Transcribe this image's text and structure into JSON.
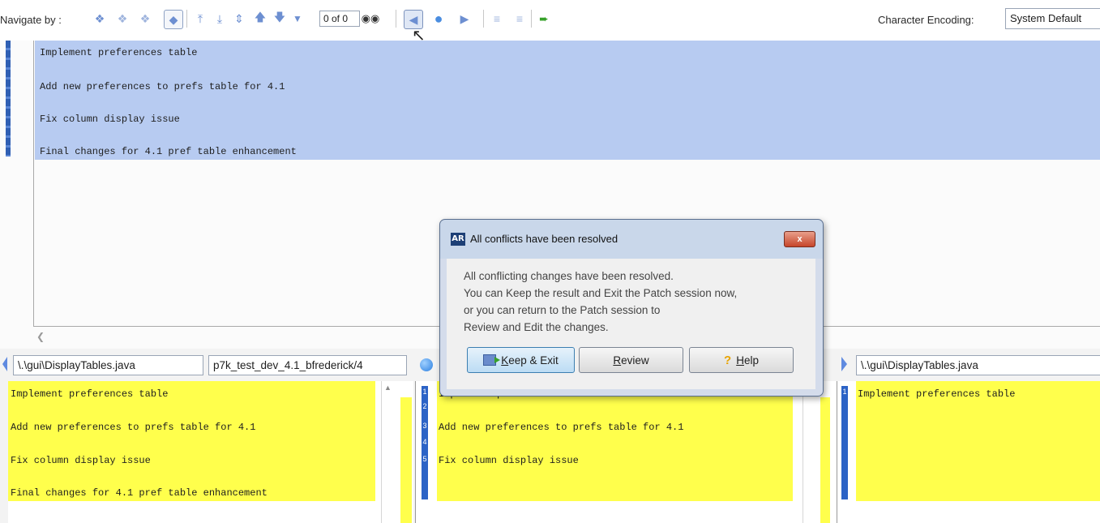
{
  "toolbar": {
    "navigate_label": "Navigate by :",
    "position_value": "0 of 0",
    "encoding_label": "Character Encoding:",
    "encoding_value": "System Default"
  },
  "icons": [
    "diff-nav-icon",
    "prev-diff-icon",
    "next-diff-icon",
    "all-diff-icon",
    "first-change-icon",
    "last-change-icon",
    "expand-icon",
    "up-arrow-icon",
    "down-arrow-icon",
    "find-icon",
    "left-arrow-icon",
    "circle-icon",
    "right-arrow-icon",
    "merge-icon",
    "merge-all-icon",
    "keep-exit-icon"
  ],
  "result_pane": {
    "lines": [
      "Implement preferences table",
      "Add new preferences to prefs table for 4.1",
      "Fix column display issue",
      "Final changes for 4.1 pref table enhancement"
    ]
  },
  "left_pane": {
    "file": "\\.\\gui\\DisplayTables.java",
    "version": "p7k_test_dev_4.1_bfrederick/4",
    "lines": [
      "Implement preferences table",
      "Add new preferences to prefs table for 4.1",
      "Fix column display issue",
      "Final changes for 4.1 pref table enhancement"
    ]
  },
  "middle_pane": {
    "line_numbers": [
      "1",
      "2",
      "3",
      "4",
      "5"
    ],
    "lines": [
      "Implement preferences table",
      "Add new preferences to prefs table for 4.1",
      "Fix column display issue"
    ]
  },
  "right_pane": {
    "file": "\\.\\gui\\DisplayTables.java",
    "line_numbers": [
      "1"
    ],
    "lines": [
      "Implement preferences table"
    ]
  },
  "dialog": {
    "icon_text": "AR",
    "title": "All conflicts have been resolved",
    "close": "x",
    "message": [
      "All conflicting changes have been resolved.",
      "You can Keep the result and Exit the Patch session now,",
      "or you can return to the Patch session to",
      "Review and Edit the changes."
    ],
    "buttons": {
      "keep_exit_mnemonic": "K",
      "keep_exit_rest": "eep & Exit",
      "review_mnemonic": "R",
      "review_rest": "eview",
      "help_mnemonic": "H",
      "help_rest": "elp"
    }
  },
  "colors": {
    "selection": "#b7cbf1",
    "change_yellow": "#ffff4c",
    "marker_blue": "#2c63c6"
  }
}
